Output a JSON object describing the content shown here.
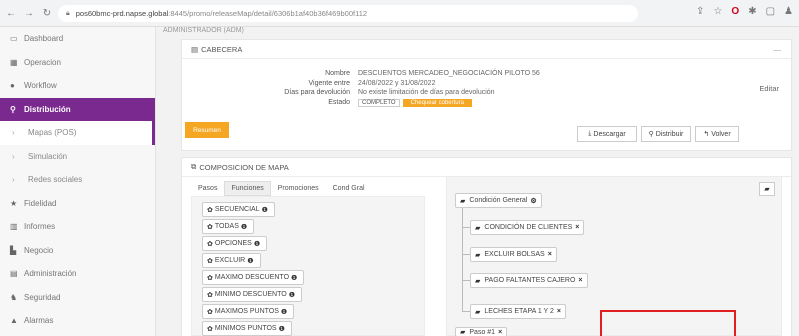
{
  "browser": {
    "url_host": "pos60bmc-prd.napse.global",
    "url_path": ":8445/promo/releaseMap/detail/6306b1af40b36f469b00f112"
  },
  "user_strip": "ADMINISTRADOR (ADM)",
  "sidebar": {
    "items": [
      {
        "label": "Dashboard",
        "icon": "dashboard-icon"
      },
      {
        "label": "Operacion",
        "icon": "grid-icon"
      },
      {
        "label": "Workflow",
        "icon": "globe-icon"
      },
      {
        "label": "Distribución",
        "icon": "map-marker-icon"
      },
      {
        "label": "Mapas (POS)",
        "icon": "chevron-right-icon"
      },
      {
        "label": "Simulación",
        "icon": "chevron-right-icon"
      },
      {
        "label": "Redes sociales",
        "icon": "chevron-right-icon"
      },
      {
        "label": "Fidelidad",
        "icon": "star-icon"
      },
      {
        "label": "Informes",
        "icon": "chart-icon"
      },
      {
        "label": "Negocio",
        "icon": "building-icon"
      },
      {
        "label": "Administración",
        "icon": "calendar-icon"
      },
      {
        "label": "Seguridad",
        "icon": "users-icon"
      },
      {
        "label": "Alarmas",
        "icon": "bell-icon"
      }
    ]
  },
  "cabecera": {
    "title": "CABECERA",
    "collapse": "—",
    "nombre_label": "Nombre",
    "nombre_value": "DESCUENTOS MERCADEO_NEGOCIACIÓN PILOTO 56",
    "vigente_label": "Vigente entre",
    "vigente_value": "24/08/2022 y 31/08/2022",
    "dias_label": "Días para devolución",
    "dias_value": "No existe limitación de días para devolución",
    "estado_label": "Estado",
    "estado_badge": "COMPLETO",
    "estado_action": "Chequear cobertura",
    "edit": "Editar"
  },
  "actions": {
    "resumen": "Resumen",
    "descargar": "Descargar",
    "distribuir": "Distribuir",
    "volver": "Volver"
  },
  "composicion": {
    "title": "COMPOSICION DE MAPA",
    "tabs": [
      "Pasos",
      "Funciones",
      "Promociones",
      "Cond Gral"
    ],
    "functions": [
      "SECUENCIAL",
      "TODAS",
      "OPCIONES",
      "EXCLUIR",
      "MAXIMO DESCUENTO",
      "MINIMO DESCUENTO",
      "MAXIMOS PUNTOS",
      "MINIMOS PUNTOS"
    ],
    "tree_root": "Condición General",
    "tree_items": [
      "CONDICIÓN DE CLIENTES",
      "EXCLUIR BOLSAS",
      "PAGO FALTANTES CAJERO",
      "LECHES ETAPA 1 Y 2"
    ],
    "tree_bottom": "Paso #1"
  }
}
